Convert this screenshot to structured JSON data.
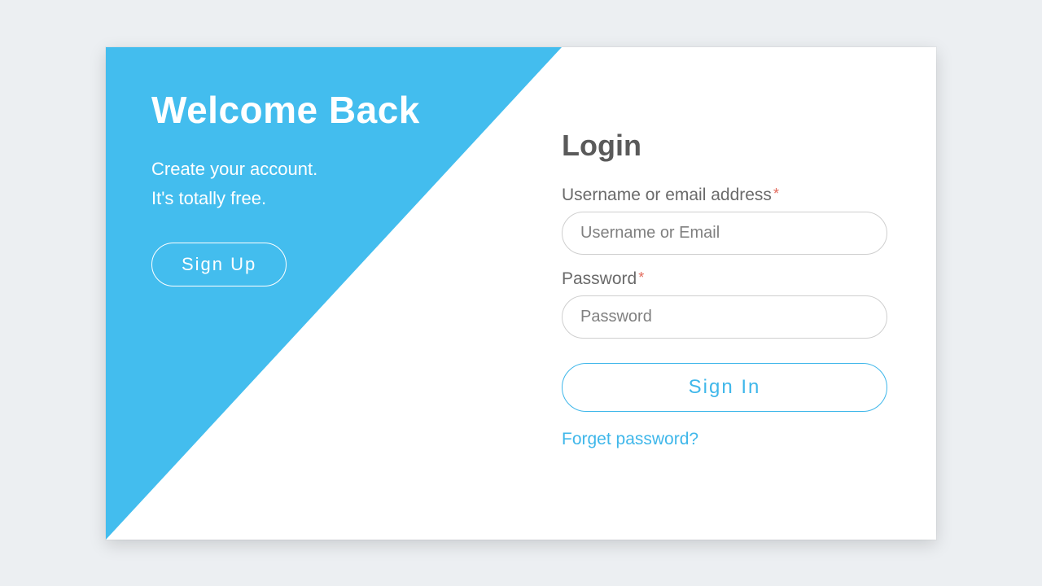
{
  "left": {
    "title": "Welcome Back",
    "subtitle_line1": "Create your account.",
    "subtitle_line2": "It's totally free.",
    "signup_label": "Sign Up"
  },
  "login": {
    "heading": "Login",
    "username_label": "Username or email address",
    "username_placeholder": "Username or Email",
    "password_label": "Password",
    "password_placeholder": "Password",
    "required_mark": "*",
    "submit_label": "Sign In",
    "forgot_label": "Forget password?"
  }
}
